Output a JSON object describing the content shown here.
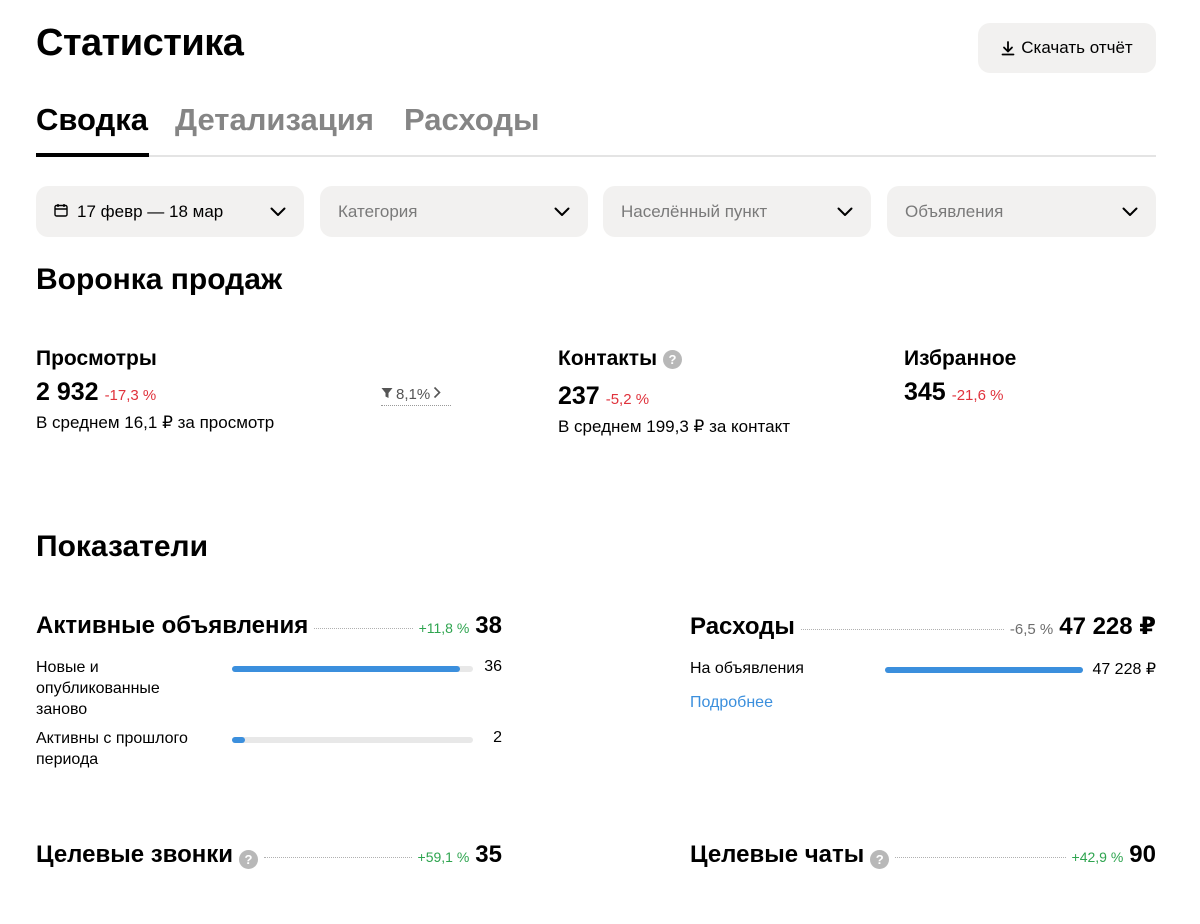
{
  "header": {
    "title": "Статистика",
    "download_label": "Скачать отчёт"
  },
  "tabs": [
    {
      "label": "Сводка",
      "active": true
    },
    {
      "label": "Детализация",
      "active": false
    },
    {
      "label": "Расходы",
      "active": false
    }
  ],
  "filters": {
    "date": "17 февр — 18 мар",
    "category": "Категория",
    "city": "Населённый пункт",
    "ads": "Объявления"
  },
  "funnel": {
    "title": "Воронка продаж",
    "views": {
      "label": "Просмотры",
      "value": "2 932",
      "change": "-17,3 %",
      "sub": "В среднем 16,1 ₽ за просмотр",
      "conversion": "8,1%"
    },
    "contacts": {
      "label": "Контакты",
      "value": "237",
      "change": "-5,2 %",
      "sub": "В среднем 199,3 ₽ за контакт"
    },
    "favorites": {
      "label": "Избранное",
      "value": "345",
      "change": "-21,6 %"
    }
  },
  "indicators": {
    "title": "Показатели",
    "active_ads": {
      "label": "Активные объявления",
      "change": "+11,8 %",
      "value": "38",
      "rows": [
        {
          "label": "Новые и опубликованные заново",
          "value": "36",
          "fraction": 0.947
        },
        {
          "label": "Активны с прошлого периода",
          "value": "2",
          "fraction": 0.053
        }
      ]
    },
    "expenses": {
      "label": "Расходы",
      "change": "-6,5 %",
      "value": "47 228 ₽",
      "rows": [
        {
          "label": "На объявления",
          "value": "47 228 ₽",
          "fraction": 1.0
        }
      ],
      "link": "Подробнее"
    },
    "target_calls": {
      "label": "Целевые звонки",
      "change": "+59,1 %",
      "value": "35"
    },
    "target_chats": {
      "label": "Целевые чаты",
      "change": "+42,9 %",
      "value": "90"
    }
  },
  "colors": {
    "accent": "#3b8fdd",
    "negative": "#e0323c",
    "positive": "#2ea44f",
    "surface": "#f2f1f0"
  }
}
